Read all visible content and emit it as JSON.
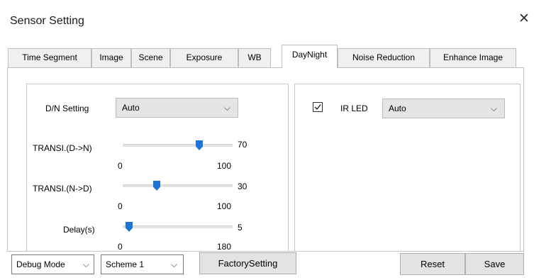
{
  "window": {
    "title": "Sensor Setting",
    "close_glyph": "✕"
  },
  "tabs": [
    {
      "label": "Time Segment"
    },
    {
      "label": "Image"
    },
    {
      "label": "Scene"
    },
    {
      "label": "Exposure"
    },
    {
      "label": "WB"
    },
    {
      "label": "DayNight",
      "active": true
    },
    {
      "label": "Noise Reduction"
    },
    {
      "label": "Enhance Image"
    }
  ],
  "left_panel": {
    "dn_setting": {
      "label": "D/N Setting",
      "value": "Auto"
    },
    "sliders": [
      {
        "label": "TRANSI.(D->N)",
        "value": "70",
        "min": "0",
        "max": "100",
        "fraction": 0.7
      },
      {
        "label": "TRANSI.(N->D)",
        "value": "30",
        "min": "0",
        "max": "100",
        "fraction": 0.3
      },
      {
        "label": "Delay(s)",
        "value": "5",
        "min": "0",
        "max": "180",
        "fraction": 0.03
      }
    ]
  },
  "right_panel": {
    "ir_led": {
      "label": "IR LED",
      "checked": true,
      "value": "Auto"
    }
  },
  "footer": {
    "mode": {
      "value": "Debug Mode"
    },
    "scheme": {
      "value": "Scheme 1"
    },
    "factory_label": "FactorySetting",
    "reset_label": "Reset",
    "save_label": "Save"
  },
  "colors": {
    "accent": "#1b74d6"
  },
  "icons": {
    "close": "close-icon",
    "dropdown": "chevron-down-icon",
    "check": "check-icon"
  }
}
